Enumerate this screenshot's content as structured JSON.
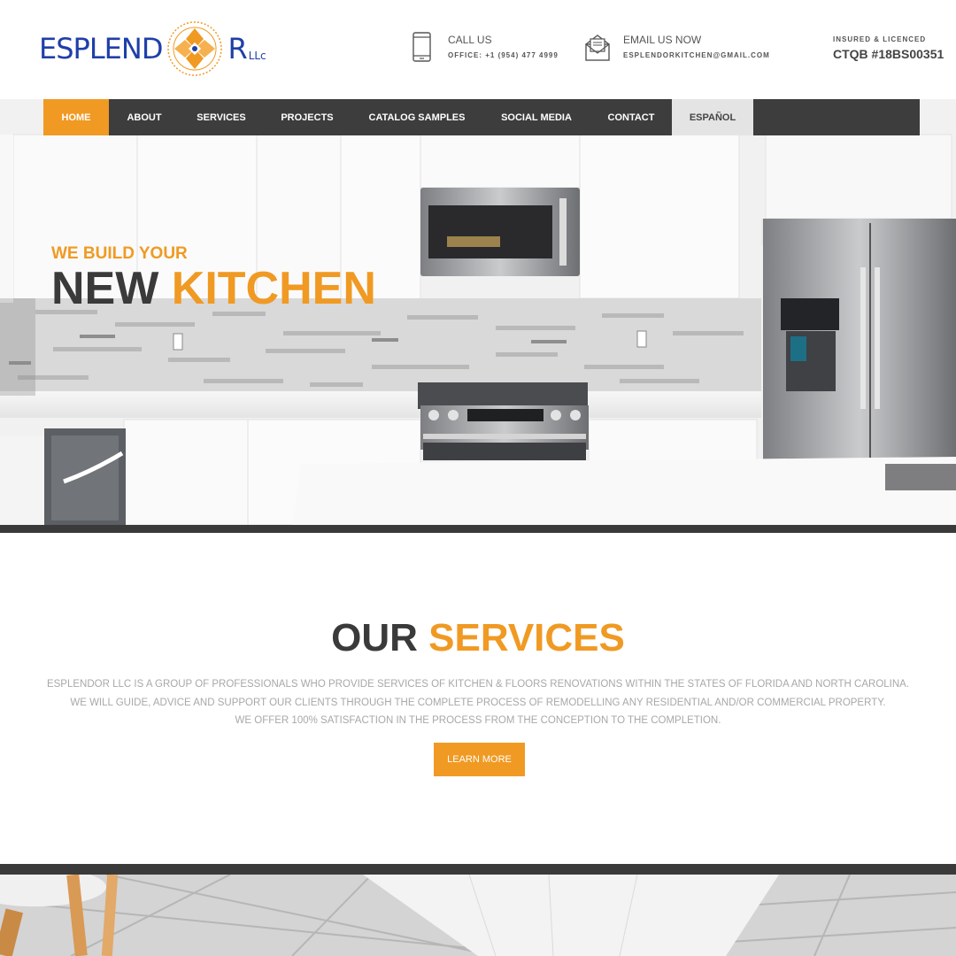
{
  "brand": {
    "logo_main": "ESPLEND",
    "logo_tail": "R",
    "logo_suffix": "LLc"
  },
  "header": {
    "call_label": "CALL US",
    "call_value": "OFFICE: +1 (954) 477 4999",
    "email_label": "EMAIL US NOW",
    "email_value": "ESPLENDORKITCHEN@GMAIL.COM",
    "insured_label": "INSURED & LICENCED",
    "insured_value": "CTQB #18BS00351",
    "phone_icon": "phone-icon",
    "email_icon": "envelope-icon"
  },
  "nav": {
    "items": [
      {
        "label": "HOME"
      },
      {
        "label": "ABOUT"
      },
      {
        "label": "SERVICES"
      },
      {
        "label": "PROJECTS"
      },
      {
        "label": "CATALOG SAMPLES"
      },
      {
        "label": "SOCIAL MEDIA"
      },
      {
        "label": "CONTACT"
      },
      {
        "label": "ESPAÑOL"
      }
    ],
    "active": "HOME"
  },
  "hero": {
    "tagline": "WE BUILD YOUR",
    "title_part1": "NEW",
    "title_part2": "KITCHEN"
  },
  "services": {
    "title_part1": "OUR",
    "title_part2": "SERVICES",
    "line1": "ESPLENDOR LLC IS A GROUP OF PROFESSIONALS WHO PROVIDE SERVICES OF KITCHEN & FLOORS RENOVATIONS WITHIN THE STATES OF FLORIDA AND NORTH CAROLINA.",
    "line2": "WE WILL GUIDE, ADVICE AND SUPPORT OUR CLIENTS THROUGH THE COMPLETE PROCESS OF REMODELLING ANY RESIDENTIAL AND/OR COMMERCIAL PROPERTY.",
    "line3": "WE OFFER 100% SATISFACTION IN THE PROCESS FROM THE CONCEPTION TO THE COMPLETION.",
    "button_label": "LEARN MORE"
  },
  "colors": {
    "accent": "#f09a23",
    "dark": "#3d3d3d",
    "brand_blue": "#1f3fa8"
  }
}
